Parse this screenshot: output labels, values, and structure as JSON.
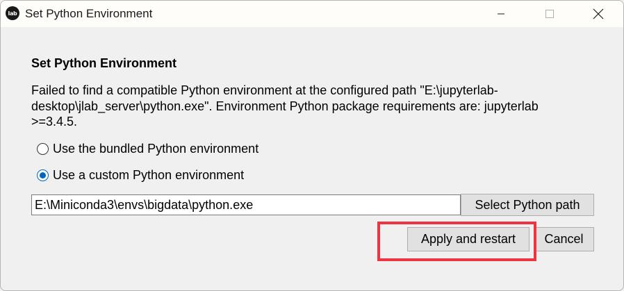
{
  "window": {
    "title": "Set Python Environment",
    "app_icon_text": "lab"
  },
  "dialog": {
    "heading": "Set Python Environment",
    "message": "Failed to find a compatible Python environment at the configured path \"E:\\jupyterlab-desktop\\jlab_server\\python.exe\". Environment Python package requirements are: jupyterlab >=3.4.5.",
    "options": [
      {
        "label": "Use the bundled Python environment",
        "selected": false
      },
      {
        "label": "Use a custom Python environment",
        "selected": true
      }
    ],
    "path_input_value": "E:\\Miniconda3\\envs\\bigdata\\python.exe",
    "select_path_label": "Select Python path",
    "apply_label": "Apply and restart",
    "cancel_label": "Cancel"
  },
  "colors": {
    "accent": "#0067c0",
    "highlight": "#ef3340"
  }
}
